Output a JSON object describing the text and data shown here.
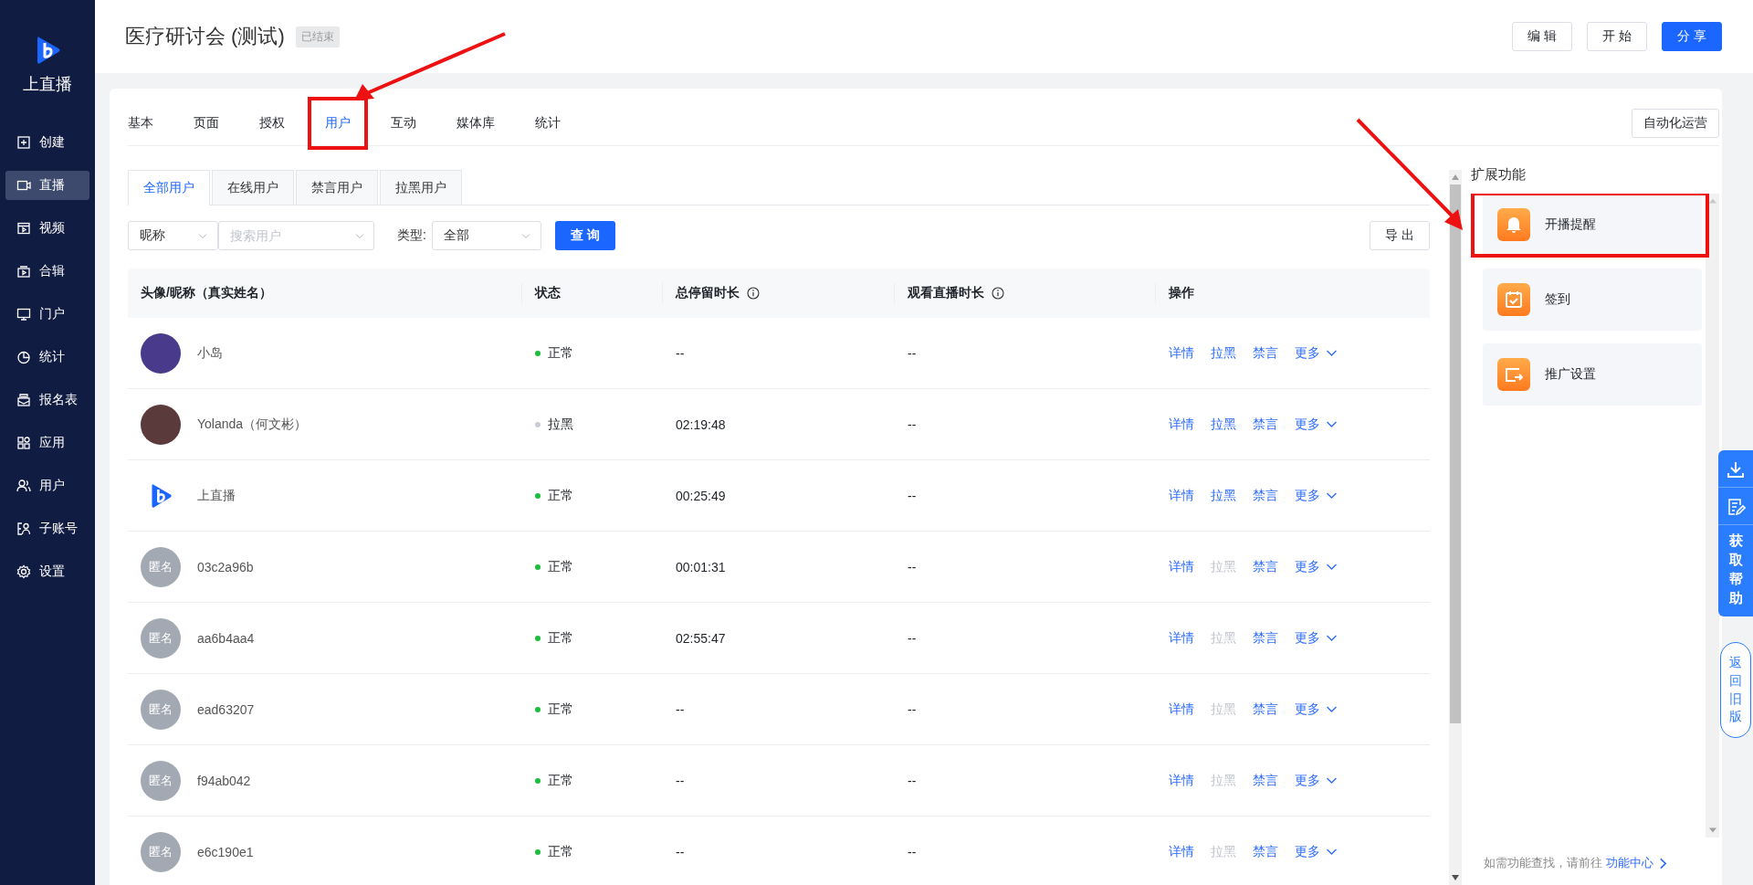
{
  "app": {
    "name": "上直播"
  },
  "sidebar": {
    "items": [
      {
        "label": "创建",
        "selected": false
      },
      {
        "label": "直播",
        "selected": true
      },
      {
        "label": "视频",
        "selected": false
      },
      {
        "label": "合辑",
        "selected": false
      },
      {
        "label": "门户",
        "selected": false
      },
      {
        "label": "统计",
        "selected": false
      },
      {
        "label": "报名表",
        "selected": false
      },
      {
        "label": "应用",
        "selected": false
      },
      {
        "label": "用户",
        "selected": false
      },
      {
        "label": "子账号",
        "selected": false
      },
      {
        "label": "设置",
        "selected": false
      }
    ]
  },
  "header": {
    "title": "医疗研讨会 (测试)",
    "badge": "已结束",
    "buttons": [
      {
        "label": "编 辑",
        "kind": "default"
      },
      {
        "label": "开 始",
        "kind": "default"
      },
      {
        "label": "分 享",
        "kind": "primary"
      }
    ]
  },
  "tabs": [
    {
      "label": "基本",
      "selected": false,
      "highlighted": false
    },
    {
      "label": "页面",
      "selected": false,
      "highlighted": false
    },
    {
      "label": "授权",
      "selected": false,
      "highlighted": false
    },
    {
      "label": "用户",
      "selected": true,
      "highlighted": true
    },
    {
      "label": "互动",
      "selected": false,
      "highlighted": false
    },
    {
      "label": "媒体库",
      "selected": false,
      "highlighted": false
    },
    {
      "label": "统计",
      "selected": false,
      "highlighted": false
    }
  ],
  "automation_button": "自动化运营",
  "user_tabs": [
    {
      "label": "全部用户",
      "selected": true
    },
    {
      "label": "在线用户",
      "selected": false
    },
    {
      "label": "禁言用户",
      "selected": false
    },
    {
      "label": "拉黑用户",
      "selected": false
    }
  ],
  "filters": {
    "field_select": "昵称",
    "search": {
      "placeholder": "搜索用户"
    },
    "type_label": "类型:",
    "type_select": "全部",
    "query_button": "查 询",
    "export_button": "导 出"
  },
  "table": {
    "columns": [
      {
        "label": "头像/昵称（真实姓名）",
        "info": false
      },
      {
        "label": "状态",
        "info": false
      },
      {
        "label": "总停留时长",
        "info": true
      },
      {
        "label": "观看直播时长",
        "info": true
      },
      {
        "label": "操作",
        "info": false
      }
    ],
    "rows": [
      {
        "avatar": {
          "kind": "photo"
        },
        "name": "小岛",
        "status": {
          "label": "正常",
          "color": "#19be3b"
        },
        "stay": "--",
        "watch": "--",
        "actions": [
          {
            "label": "详情",
            "kind": "link",
            "disabled": false
          },
          {
            "label": "拉黑",
            "kind": "link",
            "disabled": false
          },
          {
            "label": "禁言",
            "kind": "link",
            "disabled": false
          },
          {
            "label": "更多",
            "kind": "dropdown",
            "disabled": false
          }
        ]
      },
      {
        "avatar": {
          "kind": "photo"
        },
        "name": "Yolanda（何文彬）",
        "status": {
          "label": "拉黑",
          "color": "#c9cdd4"
        },
        "stay": "02:19:48",
        "watch": "--",
        "actions": [
          {
            "label": "详情",
            "kind": "link",
            "disabled": false
          },
          {
            "label": "拉黑",
            "kind": "link",
            "disabled": false
          },
          {
            "label": "禁言",
            "kind": "link",
            "disabled": false
          },
          {
            "label": "更多",
            "kind": "dropdown",
            "disabled": false
          }
        ]
      },
      {
        "avatar": {
          "kind": "logo"
        },
        "name": "上直播",
        "status": {
          "label": "正常",
          "color": "#19be3b"
        },
        "stay": "00:25:49",
        "watch": "--",
        "actions": [
          {
            "label": "详情",
            "kind": "link",
            "disabled": false
          },
          {
            "label": "拉黑",
            "kind": "link",
            "disabled": false
          },
          {
            "label": "禁言",
            "kind": "link",
            "disabled": false
          },
          {
            "label": "更多",
            "kind": "dropdown",
            "disabled": false
          }
        ]
      },
      {
        "avatar": {
          "kind": "anonymous",
          "text": "匿名"
        },
        "name": "03c2a96b",
        "status": {
          "label": "正常",
          "color": "#19be3b"
        },
        "stay": "00:01:31",
        "watch": "--",
        "actions": [
          {
            "label": "详情",
            "kind": "link",
            "disabled": false
          },
          {
            "label": "拉黑",
            "kind": "link",
            "disabled": true
          },
          {
            "label": "禁言",
            "kind": "link",
            "disabled": false
          },
          {
            "label": "更多",
            "kind": "dropdown",
            "disabled": false
          }
        ]
      },
      {
        "avatar": {
          "kind": "anonymous",
          "text": "匿名"
        },
        "name": "aa6b4aa4",
        "status": {
          "label": "正常",
          "color": "#19be3b"
        },
        "stay": "02:55:47",
        "watch": "--",
        "actions": [
          {
            "label": "详情",
            "kind": "link",
            "disabled": false
          },
          {
            "label": "拉黑",
            "kind": "link",
            "disabled": true
          },
          {
            "label": "禁言",
            "kind": "link",
            "disabled": false
          },
          {
            "label": "更多",
            "kind": "dropdown",
            "disabled": false
          }
        ]
      },
      {
        "avatar": {
          "kind": "anonymous",
          "text": "匿名"
        },
        "name": "ead63207",
        "status": {
          "label": "正常",
          "color": "#19be3b"
        },
        "stay": "--",
        "watch": "--",
        "actions": [
          {
            "label": "详情",
            "kind": "link",
            "disabled": false
          },
          {
            "label": "拉黑",
            "kind": "link",
            "disabled": true
          },
          {
            "label": "禁言",
            "kind": "link",
            "disabled": false
          },
          {
            "label": "更多",
            "kind": "dropdown",
            "disabled": false
          }
        ]
      },
      {
        "avatar": {
          "kind": "anonymous",
          "text": "匿名"
        },
        "name": "f94ab042",
        "status": {
          "label": "正常",
          "color": "#19be3b"
        },
        "stay": "--",
        "watch": "--",
        "actions": [
          {
            "label": "详情",
            "kind": "link",
            "disabled": false
          },
          {
            "label": "拉黑",
            "kind": "link",
            "disabled": true
          },
          {
            "label": "禁言",
            "kind": "link",
            "disabled": false
          },
          {
            "label": "更多",
            "kind": "dropdown",
            "disabled": false
          }
        ]
      },
      {
        "avatar": {
          "kind": "anonymous",
          "text": "匿名"
        },
        "name": "e6c190e1",
        "status": {
          "label": "正常",
          "color": "#19be3b"
        },
        "stay": "--",
        "watch": "--",
        "actions": [
          {
            "label": "详情",
            "kind": "link",
            "disabled": false
          },
          {
            "label": "拉黑",
            "kind": "link",
            "disabled": true
          },
          {
            "label": "禁言",
            "kind": "link",
            "disabled": false
          },
          {
            "label": "更多",
            "kind": "dropdown",
            "disabled": false
          }
        ]
      }
    ]
  },
  "extensions": {
    "title": "扩展功能",
    "items": [
      {
        "label": "开播提醒",
        "highlighted": true
      },
      {
        "label": "签到",
        "highlighted": false
      },
      {
        "label": "推广设置",
        "highlighted": false
      }
    ],
    "footer": "如需功能查找，请前往",
    "footer_link": "功能中心"
  },
  "help_bar": {
    "label": "获取帮助"
  },
  "old_version": "返回旧版"
}
